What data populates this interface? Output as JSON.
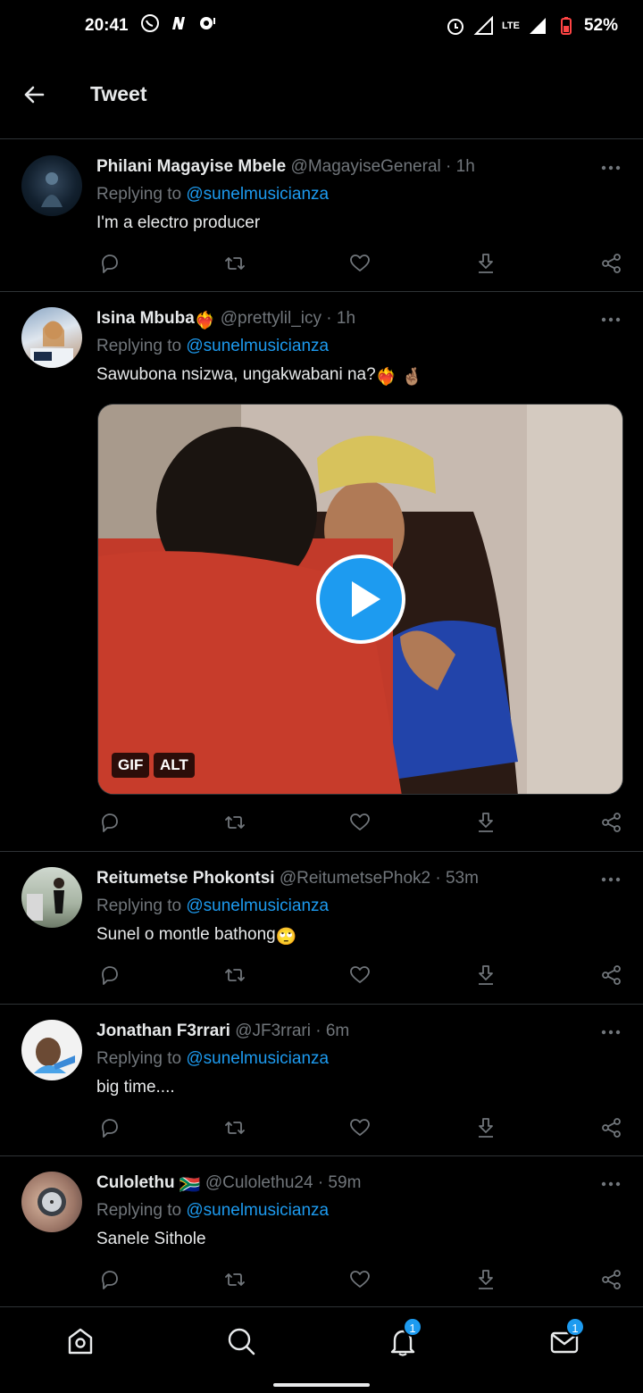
{
  "status_bar": {
    "time": "20:41",
    "battery": "52%",
    "network": "LTE",
    "icons_left": [
      "whatsapp-icon",
      "n-app-icon",
      "chat-app-icon"
    ],
    "icons_right": [
      "alarm-icon",
      "signal-icon",
      "lte-icon",
      "signal-icon",
      "battery-icon"
    ]
  },
  "header": {
    "title": "Tweet"
  },
  "replying_prefix": "Replying to",
  "tweets": [
    {
      "name": "Philani Magayise Mbele",
      "handle": "@MagayiseGeneral",
      "time": "· 1h",
      "replying_to": "@sunelmusicianza",
      "text": "I'm a electro producer"
    },
    {
      "name": "Isina Mbuba",
      "name_emoji": "❤️‍🔥",
      "handle": "@prettylil_icy",
      "time": "· 1h",
      "replying_to": "@sunelmusicianza",
      "text": "Sawubona nsizwa, ungakwabani na?",
      "text_emoji": "❤️‍🔥 🤞🏽",
      "media": {
        "badge_gif": "GIF",
        "badge_alt": "ALT"
      }
    },
    {
      "name": "Reitumetse Phokontsi",
      "handle": "@ReitumetsePhok2",
      "time": "· 53m",
      "replying_to": "@sunelmusicianza",
      "text": "Sunel o montle bathong",
      "text_emoji": "🙄"
    },
    {
      "name": "Jonathan F3rrari",
      "handle": "@JF3rrari",
      "time": "· 6m",
      "replying_to": "@sunelmusicianza",
      "text": "big time...."
    },
    {
      "name": "Culolethu",
      "name_emoji": "🇿🇦",
      "handle": "@Culolethu24",
      "time": "· 59m",
      "replying_to": "@sunelmusicianza",
      "text": "Sanele Sithole"
    }
  ],
  "bottom_nav": {
    "notifications_badge": "1",
    "messages_badge": "1"
  },
  "colors": {
    "accent": "#1d9bf0",
    "background": "#000000",
    "muted": "#71767b",
    "divider": "#2f3336"
  }
}
